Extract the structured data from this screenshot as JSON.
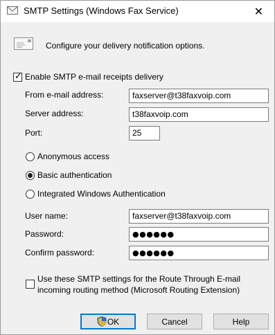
{
  "window": {
    "title": "SMTP Settings (Windows Fax Service)",
    "close_glyph": "✕"
  },
  "header": {
    "text": "Configure your delivery notification options."
  },
  "enable_smtp": {
    "label": "Enable SMTP e-mail receipts delivery",
    "checked": true
  },
  "fields": {
    "from_label": "From e-mail address:",
    "from_value": "faxserver@t38faxvoip.com",
    "server_label": "Server address:",
    "server_value": "t38faxvoip.com",
    "port_label": "Port:",
    "port_value": "25"
  },
  "auth": {
    "anonymous_label": "Anonymous access",
    "basic_label": "Basic authentication",
    "integrated_label": "Integrated Windows Authentication",
    "selected": "basic"
  },
  "credentials": {
    "username_label": "User name:",
    "username_value": "faxserver@t38faxvoip.com",
    "password_label": "Password:",
    "password_value": "●●●●●●",
    "confirm_label": "Confirm password:",
    "confirm_value": "●●●●●●"
  },
  "routing": {
    "label_line1": "Use these SMTP settings for the Route Through E-mail",
    "label_line2": "incoming routing method (Microsoft Routing Extension)",
    "checked": false
  },
  "buttons": {
    "ok": "OK",
    "cancel": "Cancel",
    "help": "Help"
  },
  "colors": {
    "accent": "#0078d7",
    "background": "#f0f0f0"
  }
}
